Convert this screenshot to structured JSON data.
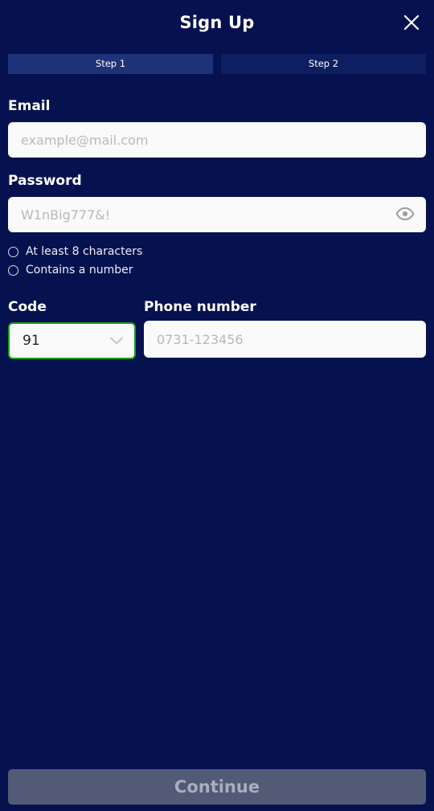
{
  "header": {
    "title": "Sign Up",
    "close_icon": "close-icon"
  },
  "steps": [
    {
      "label": "Step 1",
      "active": true
    },
    {
      "label": "Step 2",
      "active": false
    }
  ],
  "form": {
    "email": {
      "label": "Email",
      "placeholder": "example@mail.com",
      "value": ""
    },
    "password": {
      "label": "Password",
      "placeholder": "W1nBig777&!",
      "value": "",
      "toggle_icon": "eye-icon"
    },
    "rules": [
      {
        "text": "At least 8 characters",
        "checked": false
      },
      {
        "text": "Contains a number",
        "checked": false
      }
    ],
    "code": {
      "label": "Code",
      "value": "91",
      "chevron_icon": "chevron-down-icon"
    },
    "phone": {
      "label": "Phone number",
      "placeholder": "0731-123456",
      "value": ""
    }
  },
  "footer": {
    "continue_label": "Continue"
  },
  "colors": {
    "background": "#06124f",
    "tab_active": "#1d3278",
    "tab_inactive": "#0e1f61",
    "input_background": "#fafafa",
    "focus_border": "#1a9e1a",
    "button_disabled": "#535a76",
    "button_text_disabled": "#a8adc1"
  }
}
